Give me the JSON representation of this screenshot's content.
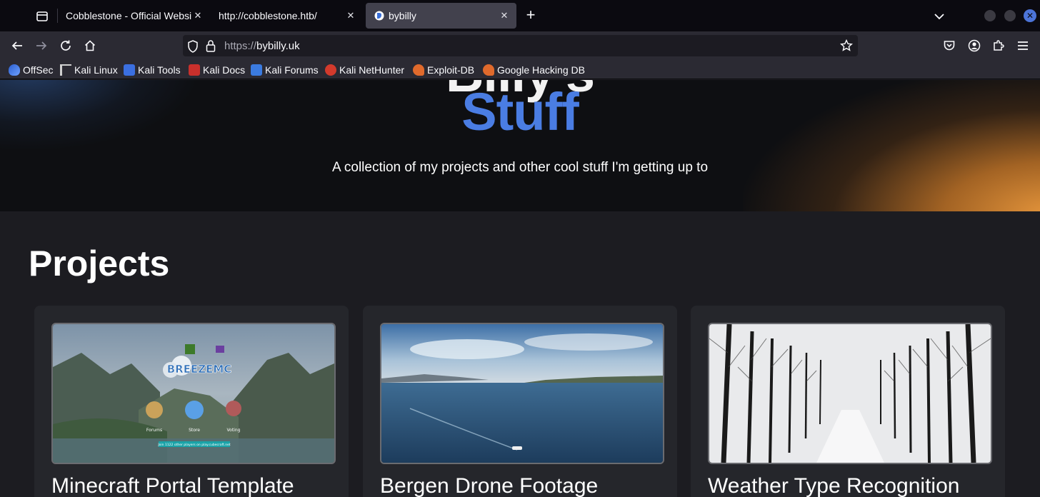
{
  "browser": {
    "tabs": [
      {
        "title": "Cobblestone - Official Websi",
        "active": false
      },
      {
        "title": "http://cobblestone.htb/",
        "active": false
      },
      {
        "title": "bybilly",
        "active": true
      }
    ],
    "new_tab_label": "+",
    "url_scheme": "https://",
    "url_host": "bybilly.uk",
    "bookmarks": [
      {
        "label": "OffSec",
        "icon": "offsec-icon",
        "color": "#3a6fd8"
      },
      {
        "label": "Kali Linux",
        "icon": "kali-icon",
        "color": "#d0d0d0"
      },
      {
        "label": "Kali Tools",
        "icon": "kali-tools-icon",
        "color": "#3b6fe0"
      },
      {
        "label": "Kali Docs",
        "icon": "kali-docs-icon",
        "color": "#d33a2c"
      },
      {
        "label": "Kali Forums",
        "icon": "kali-forums-icon",
        "color": "#3b7be0"
      },
      {
        "label": "Kali NetHunter",
        "icon": "nethunter-icon",
        "color": "#d33a2c"
      },
      {
        "label": "Exploit-DB",
        "icon": "exploitdb-icon",
        "color": "#e06a2c"
      },
      {
        "label": "Google Hacking DB",
        "icon": "ghdb-icon",
        "color": "#e06a2c"
      }
    ]
  },
  "hero": {
    "title_partial": "Billy's",
    "title_accent": "Stuff",
    "tagline": "A collection of my projects and other cool stuff I'm getting up to"
  },
  "projects": {
    "heading": "Projects",
    "cards": [
      {
        "title": "Minecraft Portal Template",
        "thumb": "minecraft-thumb"
      },
      {
        "title": "Bergen Drone Footage",
        "thumb": "drone-thumb"
      },
      {
        "title": "Weather Type Recognition",
        "thumb": "snow-thumb"
      }
    ],
    "minecraft_thumb_text": {
      "logo": "BREEZEMC",
      "links": [
        "Forums",
        "Store",
        "Voting"
      ],
      "status_bar": "Join 1122 other players on play.cubecraft.net"
    }
  },
  "colors": {
    "accent_blue": "#4a7de3",
    "page_bg": "#1c1c21",
    "card_bg": "#25262b",
    "hero_bg": "#0e0f12",
    "hero_glow": "#e6963c"
  }
}
